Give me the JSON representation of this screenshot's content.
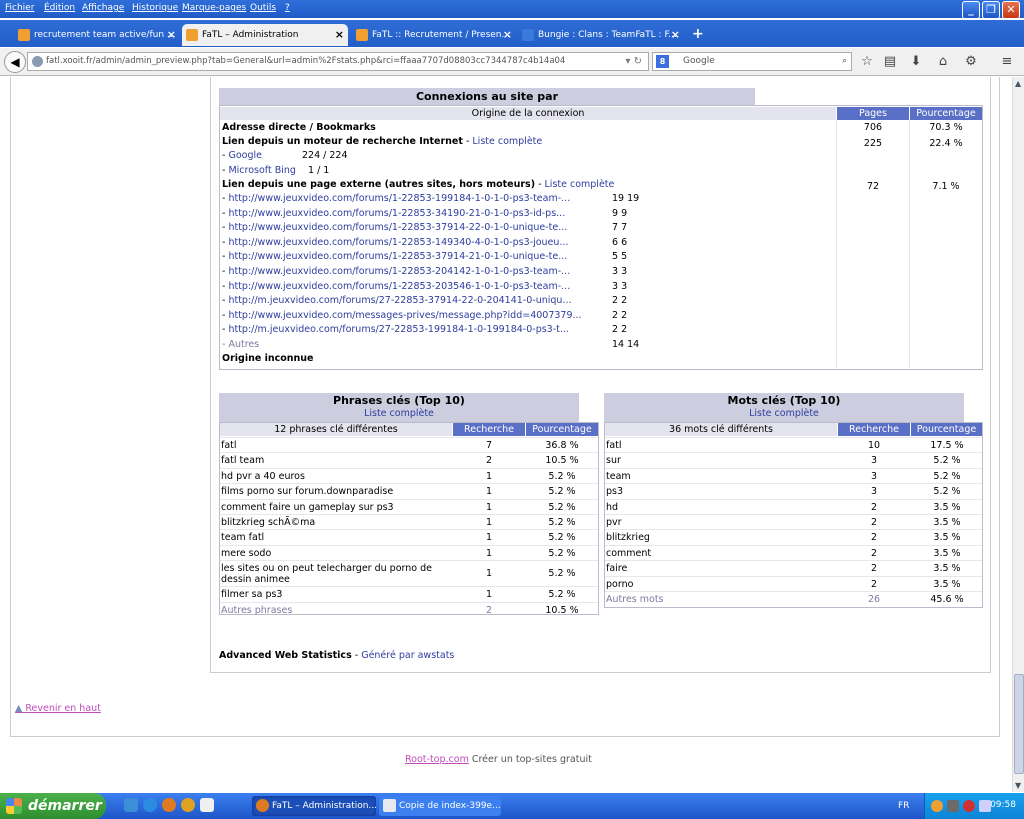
{
  "menu": [
    "Fichier",
    "Édition",
    "Affichage",
    "Historique",
    "Marque-pages",
    "Outils",
    "?"
  ],
  "tabs": [
    {
      "label": "recrutement team active/fun ...",
      "active": false
    },
    {
      "label": "FaTL – Administration",
      "active": true
    },
    {
      "label": "FaTL :: Recrutement / Presen...",
      "active": false
    },
    {
      "label": "Bungie : Clans : TeamFaTL : F...",
      "active": false
    }
  ],
  "url": "fatl.xooit.fr/admin/admin_preview.php?tab=General&url=admin%2Fstats.php&rci=ffaaa7707d08803cc7344787c4b14a04",
  "search_placeholder": "Google",
  "connexions": {
    "title": "Connexions au site par",
    "col_origin": "Origine de la connexion",
    "col_pages": "Pages",
    "col_percent": "Pourcentage",
    "direct": {
      "label": "Adresse directe / Bookmarks",
      "pages": "706",
      "percent": "70.3 %"
    },
    "engines": {
      "label": "Lien depuis un moteur de recherche Internet",
      "link": "Liste complète",
      "pages": "225",
      "percent": "22.4 %",
      "items": [
        {
          "name": "Google",
          "value": "224 / 224"
        },
        {
          "name": "Microsoft Bing",
          "value": "1    / 1"
        }
      ]
    },
    "external": {
      "label": "Lien depuis une page externe (autres sites, hors moteurs)",
      "link": "Liste complète",
      "pages": "72",
      "percent": "7.1 %",
      "items": [
        {
          "url": "http://www.jeuxvideo.com/forums/1-22853-199184-1-0-1-0-ps3-team-...",
          "v": "19 19"
        },
        {
          "url": "http://www.jeuxvideo.com/forums/1-22853-34190-21-0-1-0-ps3-id-ps...",
          "v": "9  9"
        },
        {
          "url": "http://www.jeuxvideo.com/forums/1-22853-37914-22-0-1-0-unique-te...",
          "v": "7  7"
        },
        {
          "url": "http://www.jeuxvideo.com/forums/1-22853-149340-4-0-1-0-ps3-joueu...",
          "v": "6  6"
        },
        {
          "url": "http://www.jeuxvideo.com/forums/1-22853-37914-21-0-1-0-unique-te...",
          "v": "5  5"
        },
        {
          "url": "http://www.jeuxvideo.com/forums/1-22853-204142-1-0-1-0-ps3-team-...",
          "v": "3  3"
        },
        {
          "url": "http://www.jeuxvideo.com/forums/1-22853-203546-1-0-1-0-ps3-team-...",
          "v": "3  3"
        },
        {
          "url": "http://m.jeuxvideo.com/forums/27-22853-37914-22-0-204141-0-uniqu...",
          "v": "2  2"
        },
        {
          "url": "http://www.jeuxvideo.com/messages-prives/message.php?idd=4007379...",
          "v": "2  2"
        },
        {
          "url": "http://m.jeuxvideo.com/forums/27-22853-199184-1-0-199184-0-ps3-t...",
          "v": "2  2"
        }
      ],
      "others": "Autres",
      "others_v": "14 14"
    },
    "unknown": "Origine inconnue"
  },
  "phrases": {
    "title": "Phrases clés (Top 10)",
    "link": "Liste complète",
    "count_label": "12 phrases clé différentes",
    "col_search": "Recherche",
    "col_percent": "Pourcentage",
    "rows": [
      {
        "k": "fatl",
        "n": "7",
        "p": "36.8 %"
      },
      {
        "k": "fatl team",
        "n": "2",
        "p": "10.5 %"
      },
      {
        "k": "hd pvr a 40 euros",
        "n": "1",
        "p": "5.2 %"
      },
      {
        "k": "films porno sur forum.downparadise",
        "n": "1",
        "p": "5.2 %"
      },
      {
        "k": "comment faire un gameplay sur ps3",
        "n": "1",
        "p": "5.2 %"
      },
      {
        "k": "blitzkrieg schÃ©ma",
        "n": "1",
        "p": "5.2 %"
      },
      {
        "k": "team fatl",
        "n": "1",
        "p": "5.2 %"
      },
      {
        "k": "mere sodo",
        "n": "1",
        "p": "5.2 %"
      },
      {
        "k": "les sites ou on peut telecharger du porno de dessin animee",
        "n": "1",
        "p": "5.2 %"
      },
      {
        "k": "filmer sa ps3",
        "n": "1",
        "p": "5.2 %"
      }
    ],
    "others": {
      "k": "Autres phrases",
      "n": "2",
      "p": "10.5 %"
    }
  },
  "mots": {
    "title": "Mots clés (Top 10)",
    "link": "Liste complète",
    "count_label": "36 mots clé différents",
    "col_search": "Recherche",
    "col_percent": "Pourcentage",
    "rows": [
      {
        "k": "fatl",
        "n": "10",
        "p": "17.5 %"
      },
      {
        "k": "sur",
        "n": "3",
        "p": "5.2 %"
      },
      {
        "k": "team",
        "n": "3",
        "p": "5.2 %"
      },
      {
        "k": "ps3",
        "n": "3",
        "p": "5.2 %"
      },
      {
        "k": "hd",
        "n": "2",
        "p": "3.5 %"
      },
      {
        "k": "pvr",
        "n": "2",
        "p": "3.5 %"
      },
      {
        "k": "blitzkrieg",
        "n": "2",
        "p": "3.5 %"
      },
      {
        "k": "comment",
        "n": "2",
        "p": "3.5 %"
      },
      {
        "k": "faire",
        "n": "2",
        "p": "3.5 %"
      },
      {
        "k": "porno",
        "n": "2",
        "p": "3.5 %"
      }
    ],
    "others": {
      "k": "Autres mots",
      "n": "26",
      "p": "45.6 %"
    }
  },
  "footer": {
    "aws_label": "Advanced Web Statistics",
    "aws_sep": " - ",
    "aws_link": "Généré par awstats",
    "back_top": "Revenir en haut",
    "roottop_link": "Root-top.com",
    "roottop_text": " Créer un top-sites gratuit"
  },
  "taskbar": {
    "start": "démarrer",
    "tasks": [
      "FaTL – Administration...",
      "Copie de index-399e..."
    ],
    "lang": "FR",
    "clock": "09:58"
  },
  "colors": {
    "header_bg": "#cccdde",
    "col_head": "#5a6fc6",
    "link": "#2d3d9e",
    "visited": "#c04dbc"
  }
}
